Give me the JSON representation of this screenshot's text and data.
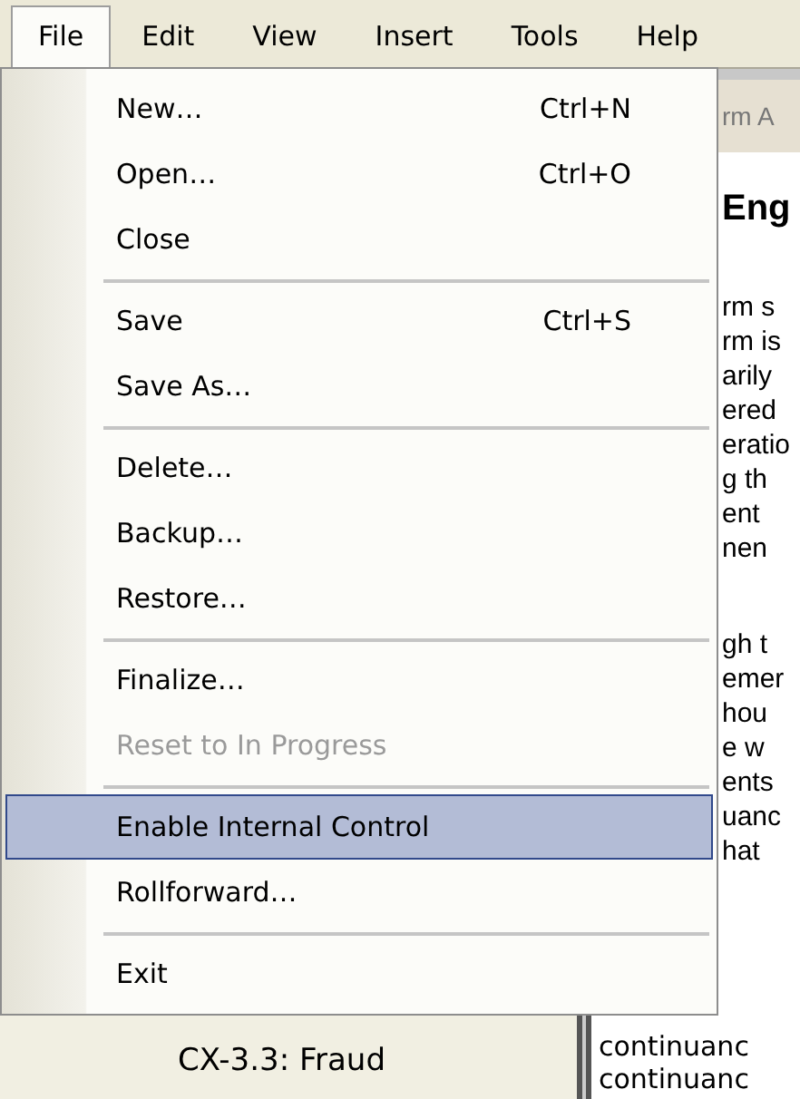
{
  "menubar": [
    {
      "label": "File",
      "selected": true
    },
    {
      "label": "Edit",
      "selected": false
    },
    {
      "label": "View",
      "selected": false
    },
    {
      "label": "Insert",
      "selected": false
    },
    {
      "label": "Tools",
      "selected": false
    },
    {
      "label": "Help",
      "selected": false
    }
  ],
  "menu": [
    {
      "kind": "item",
      "label": "New…",
      "shortcut": "Ctrl+N",
      "disabled": false,
      "selected": false
    },
    {
      "kind": "item",
      "label": "Open…",
      "shortcut": "Ctrl+O",
      "disabled": false,
      "selected": false
    },
    {
      "kind": "item",
      "label": "Close",
      "disabled": false,
      "selected": false
    },
    {
      "kind": "separator"
    },
    {
      "kind": "item",
      "label": "Save",
      "shortcut": "Ctrl+S",
      "disabled": false,
      "selected": false
    },
    {
      "kind": "item",
      "label": "Save As…",
      "disabled": false,
      "selected": false
    },
    {
      "kind": "separator"
    },
    {
      "kind": "item",
      "label": "Delete…",
      "disabled": false,
      "selected": false
    },
    {
      "kind": "item",
      "label": "Backup…",
      "disabled": false,
      "selected": false
    },
    {
      "kind": "item",
      "label": "Restore…",
      "disabled": false,
      "selected": false
    },
    {
      "kind": "separator"
    },
    {
      "kind": "item",
      "label": "Finalize…",
      "disabled": false,
      "selected": false
    },
    {
      "kind": "item",
      "label": "Reset to In Progress",
      "disabled": true,
      "selected": false
    },
    {
      "kind": "separator"
    },
    {
      "kind": "item",
      "label": "Enable Internal Control",
      "disabled": false,
      "selected": true
    },
    {
      "kind": "item",
      "label": "Rollforward…",
      "disabled": false,
      "selected": false
    },
    {
      "kind": "separator"
    },
    {
      "kind": "item",
      "label": "Exit",
      "disabled": false,
      "selected": false
    }
  ],
  "left_pane": {
    "item": "CX-3.3: Fraud"
  },
  "right_pane": {
    "tab": "rm A",
    "heading": "Eng",
    "paragraph_1": [
      "rm s",
      "rm is",
      "arily",
      "ered",
      "eratio",
      "g th",
      "ent",
      "nen"
    ],
    "paragraph_2": [
      "gh t",
      "emer",
      "hou",
      "e w",
      "ents",
      "uanc",
      "hat"
    ],
    "bottom_lines": [
      "continuanc",
      "continuanc"
    ]
  }
}
